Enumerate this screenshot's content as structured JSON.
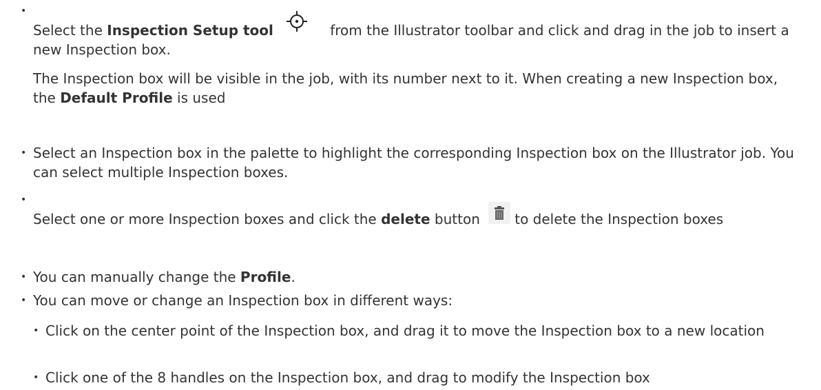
{
  "items": [
    {
      "pre": "Select the ",
      "bold": "Inspection Setup tool",
      "icon": "crosshair-target-icon",
      "post": "from the Illustrator toolbar and click and drag in the job to insert a new Inspection box.",
      "note_pre": "The Inspection box will be visible in the job, with its number next to it. When creating a new Inspection box, the ",
      "note_bold": "Default Profile",
      "note_post": " is used"
    },
    {
      "text": "Select an Inspection box in the palette to highlight the corresponding Inspection box on the Illustrator job. You can select multiple Inspection boxes."
    },
    {
      "pre": "Select one or more Inspection boxes and click the ",
      "bold": "delete",
      "mid": " button",
      "icon": "trash-icon",
      "post": "to delete the Inspection boxes"
    },
    {
      "pre": "You can manually change the ",
      "bold": "Profile",
      "post": "."
    },
    {
      "text": "You can move or change an Inspection box in different ways:",
      "sub": [
        "Click on the center point of the Inspection box, and drag it to move the Inspection box to a new location",
        "Click one of the 8 handles on the Inspection box, and drag to modify the Inspection box"
      ]
    }
  ],
  "bullet_char": "•"
}
